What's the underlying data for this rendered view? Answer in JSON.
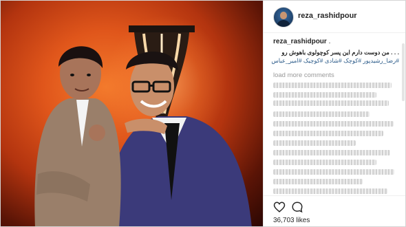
{
  "post": {
    "username": "reza_rashidpour",
    "caption_user": "reza_rashidpour",
    "caption_lines": [
      ". . . من دوست دارم این پسر کوچولوی باهوش رو",
      "#رضا_رشیدپور #کوچک #شادی #کوچیک #امیر_عباس"
    ],
    "load_more": "load more comments",
    "likes": "36,703 likes"
  },
  "icons": {
    "like": "heart-icon",
    "comment": "comment-bubble-icon"
  }
}
